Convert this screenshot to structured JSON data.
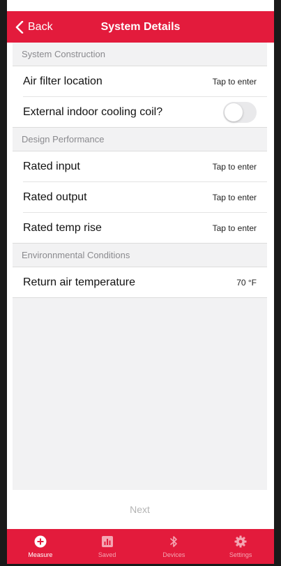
{
  "header": {
    "back_label": "Back",
    "title": "System Details"
  },
  "sections": [
    {
      "title": "System Construction",
      "rows": [
        {
          "label": "Air filter location",
          "value": "Tap to enter"
        },
        {
          "label": "External indoor cooling coil?",
          "toggle_on": false
        }
      ]
    },
    {
      "title": "Design Performance",
      "rows": [
        {
          "label": "Rated input",
          "value": "Tap to enter"
        },
        {
          "label": "Rated output",
          "value": "Tap to enter"
        },
        {
          "label": "Rated temp rise",
          "value": "Tap to enter"
        }
      ]
    },
    {
      "title": "Environnmental Conditions",
      "rows": [
        {
          "label": "Return air temperature",
          "value": "70 °F"
        }
      ]
    }
  ],
  "next_label": "Next",
  "tabs": [
    {
      "label": "Measure",
      "icon": "plus-circle-icon",
      "active": true
    },
    {
      "label": "Saved",
      "icon": "bar-chart-icon",
      "active": false
    },
    {
      "label": "Devices",
      "icon": "bluetooth-icon",
      "active": false
    },
    {
      "label": "Settings",
      "icon": "gear-icon",
      "active": false
    }
  ],
  "colors": {
    "brand_red": "#e31b3c",
    "inactive_tab_text": "#f4a5b2",
    "section_bg": "#f2f2f3"
  }
}
